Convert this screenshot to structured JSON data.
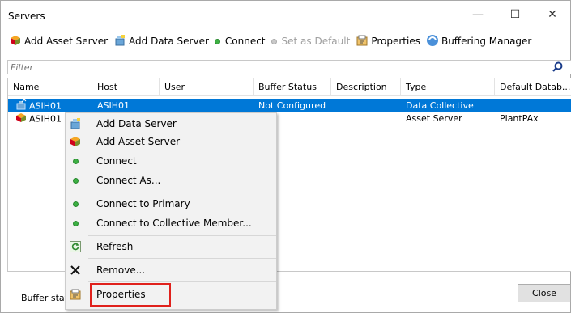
{
  "window": {
    "title": "Servers",
    "minimize_glyph": "—",
    "maximize_glyph": "☐",
    "close_glyph": "✕"
  },
  "toolbar": {
    "add_asset_server": "Add Asset Server",
    "add_data_server": "Add Data Server",
    "connect": "Connect",
    "set_as_default": "Set as Default",
    "properties": "Properties",
    "buffering_manager": "Buffering Manager"
  },
  "filter": {
    "placeholder": "Filter",
    "value": ""
  },
  "columns": [
    "Name",
    "Host",
    "User",
    "Buffer Status",
    "Description",
    "Type",
    "Default Datab..."
  ],
  "rows": [
    {
      "name": "ASIH01",
      "host": "ASIH01",
      "user": "",
      "buffer_status": "Not Configured",
      "description": "",
      "type": "Data Collective",
      "default_db": "",
      "selected": true,
      "icon": "data-server-icon"
    },
    {
      "name": "ASIH01",
      "host": "",
      "user": "",
      "buffer_status": "",
      "description": "",
      "type": "Asset Server",
      "default_db": "PlantPAx",
      "selected": false,
      "icon": "asset-server-icon"
    }
  ],
  "context_menu": {
    "add_data_server": "Add Data Server",
    "add_asset_server": "Add Asset Server",
    "connect": "Connect",
    "connect_as": "Connect As...",
    "connect_to_primary": "Connect to Primary",
    "connect_to_collective_member": "Connect to Collective Member...",
    "refresh": "Refresh",
    "remove": "Remove...",
    "properties": "Properties"
  },
  "status": {
    "text": "Buffer stat"
  },
  "buttons": {
    "close": "Close"
  },
  "colors": {
    "selection": "#0078d7",
    "highlight_box": "#e0211c",
    "connect_green": "#3cb043"
  }
}
